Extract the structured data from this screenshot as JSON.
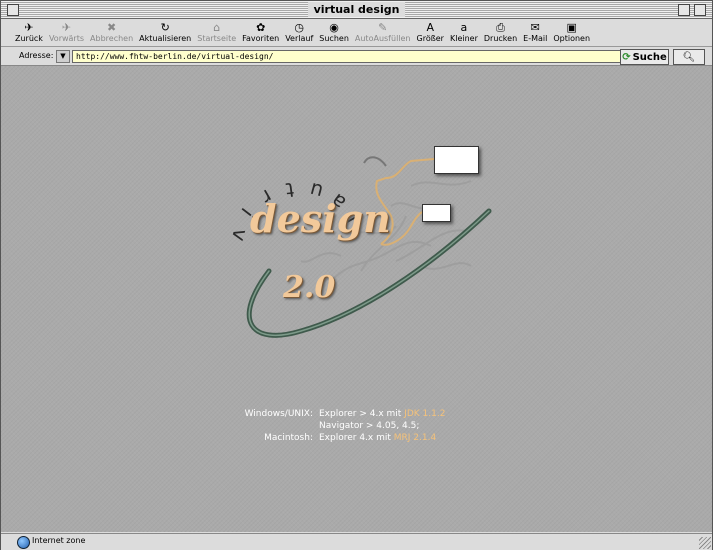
{
  "window": {
    "title": "virtual design"
  },
  "toolbar": {
    "buttons": [
      {
        "label": "Zurück",
        "icon": "back-arrow-icon",
        "glyph": "✈",
        "enabled": true
      },
      {
        "label": "Vorwärts",
        "icon": "forward-arrow-icon",
        "glyph": "✈",
        "enabled": false
      },
      {
        "label": "Abbrechen",
        "icon": "stop-icon",
        "glyph": "✖",
        "enabled": false
      },
      {
        "label": "Aktualisieren",
        "icon": "refresh-icon",
        "glyph": "↻",
        "enabled": true
      },
      {
        "label": "Startseite",
        "icon": "home-icon",
        "glyph": "⌂",
        "enabled": false
      },
      {
        "label": "Favoriten",
        "icon": "favorites-icon",
        "glyph": "✿",
        "enabled": true
      },
      {
        "label": "Verlauf",
        "icon": "history-icon",
        "glyph": "◷",
        "enabled": true
      },
      {
        "label": "Suchen",
        "icon": "search-globe-icon",
        "glyph": "◉",
        "enabled": true
      },
      {
        "label": "AutoAusfüllen",
        "icon": "autofill-icon",
        "glyph": "✎",
        "enabled": false
      },
      {
        "label": "Größer",
        "icon": "larger-text-icon",
        "glyph": "A",
        "enabled": true
      },
      {
        "label": "Kleiner",
        "icon": "smaller-text-icon",
        "glyph": "a",
        "enabled": true
      },
      {
        "label": "Drucken",
        "icon": "print-icon",
        "glyph": "⎙",
        "enabled": true
      },
      {
        "label": "E-Mail",
        "icon": "mail-icon",
        "glyph": "✉",
        "enabled": true
      },
      {
        "label": "Optionen",
        "icon": "options-icon",
        "glyph": "▣",
        "enabled": true
      }
    ]
  },
  "address": {
    "label": "Adresse:",
    "url": "http://www.fhtw-berlin.de/virtual-design/",
    "go_label": "Suche",
    "go_icon": "go-arrow-icon",
    "search_icon": "magnifier-icon"
  },
  "logo": {
    "curved_word": "virtual",
    "word": "design",
    "version": "2.0"
  },
  "requirements": [
    {
      "platform": "Windows/UNIX:",
      "text": "Explorer > 4.x mit ",
      "highlight": "JDK 1.1.2"
    },
    {
      "platform": "",
      "text": "Navigator > 4.05, 4.5;",
      "highlight": ""
    },
    {
      "platform": "Macintosh:",
      "text": "Explorer 4.x mit ",
      "highlight": "MRJ 2.1.4"
    }
  ],
  "colors": {
    "highlight": "#f5c27a",
    "logo_text": "#f2c99a",
    "address_bg": "#ffffcc"
  },
  "status": {
    "text": "Internet zone",
    "icon": "globe-icon"
  }
}
